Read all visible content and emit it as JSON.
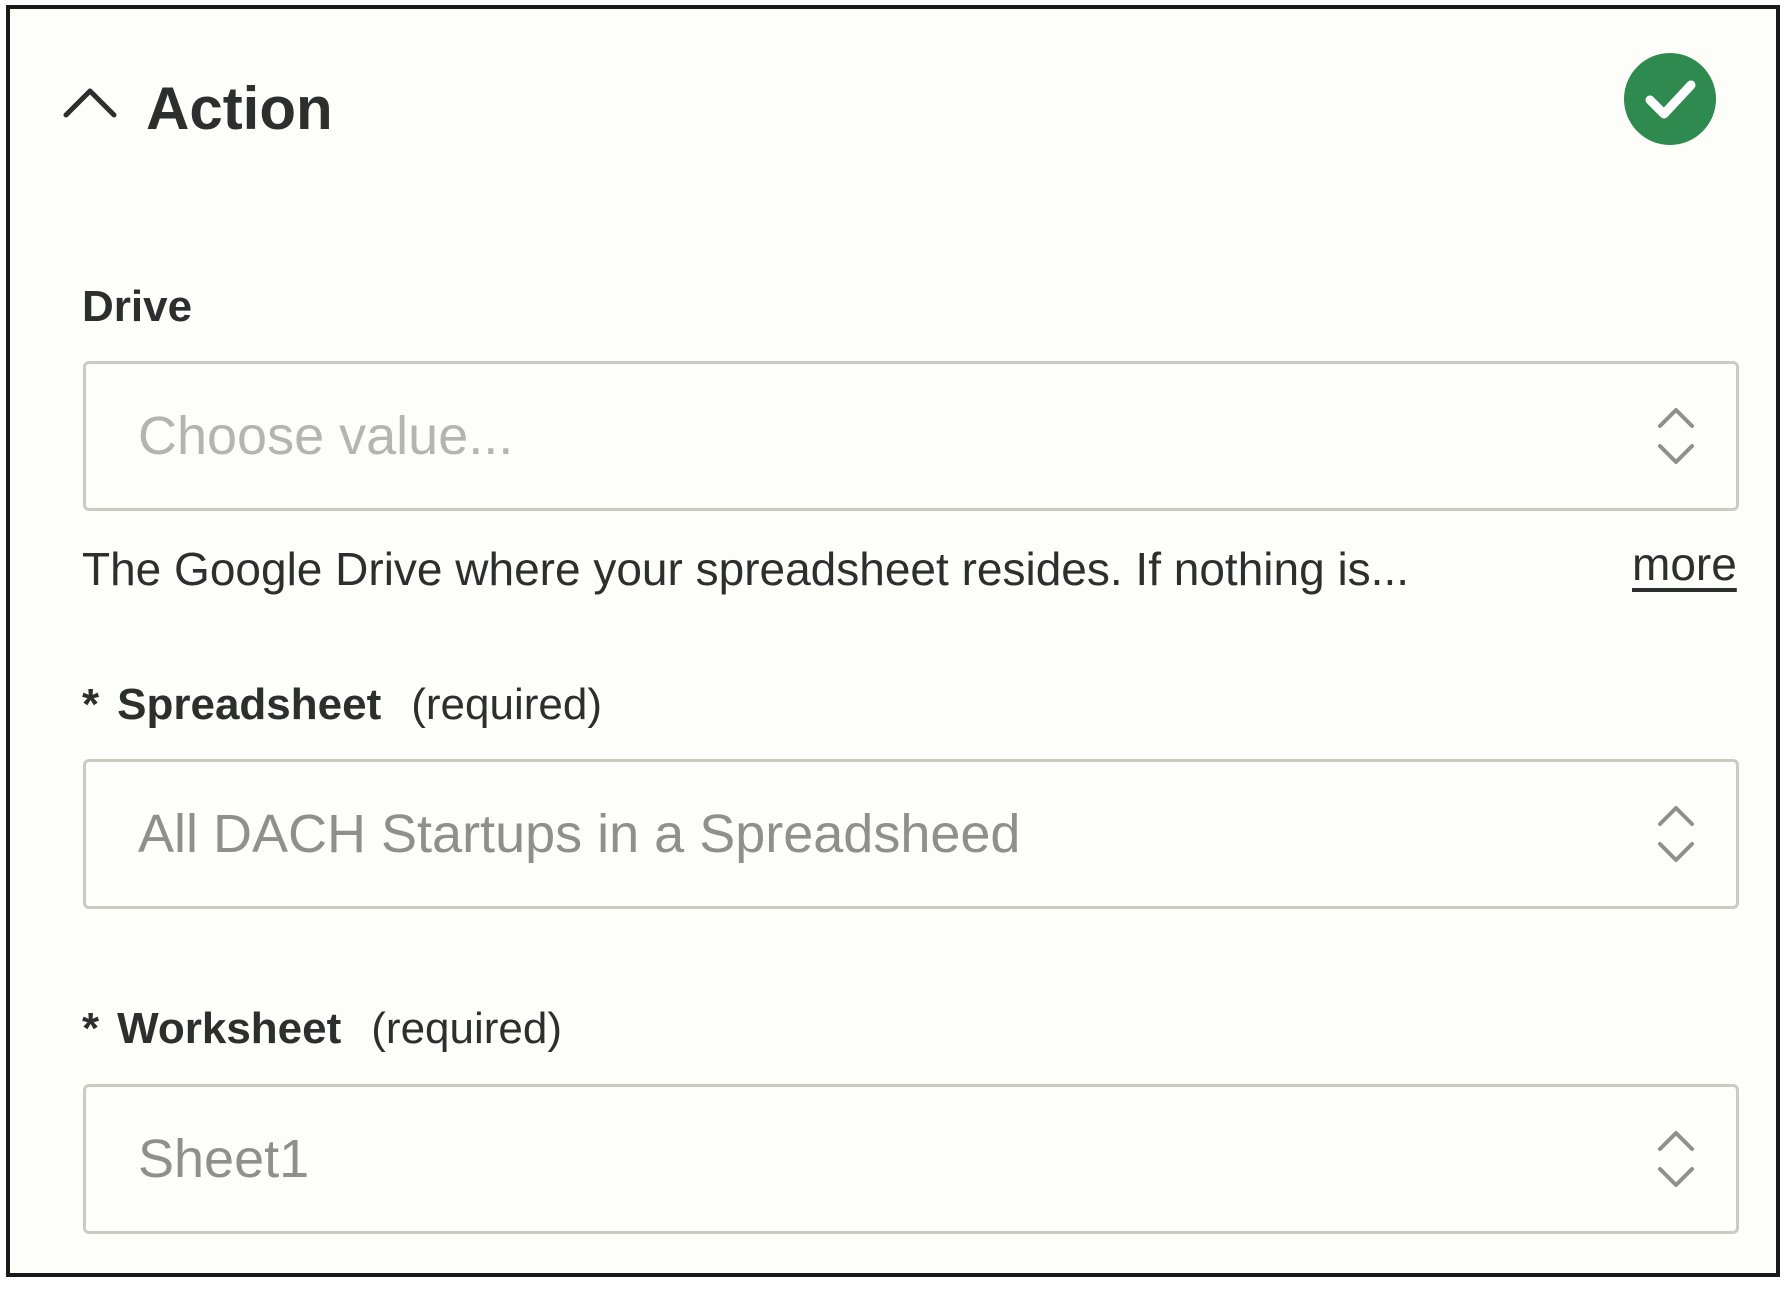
{
  "header": {
    "title": "Action",
    "collapse_icon": "chevron-up-icon",
    "status_icon": "check-circle-icon",
    "status_color": "#2f8a4f"
  },
  "fields": {
    "drive": {
      "label": "Drive",
      "placeholder": "Choose value...",
      "help_text": "The Google Drive where your spreadsheet resides. If nothing is...",
      "more_label": "more"
    },
    "spreadsheet": {
      "required_mark": "*",
      "label": "Spreadsheet",
      "required_note": "(required)",
      "value": "All DACH Startups in a Spreadsheed"
    },
    "worksheet": {
      "required_mark": "*",
      "label": "Worksheet",
      "required_note": "(required)",
      "value": "Sheet1"
    }
  },
  "icons": {
    "select_toggle": "chevron-up-down-icon"
  }
}
